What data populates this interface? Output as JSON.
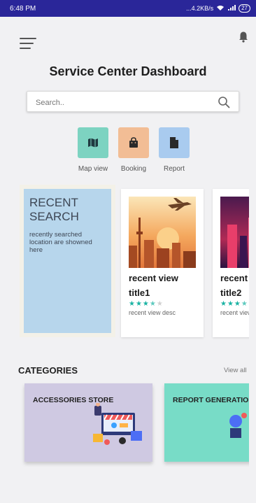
{
  "status_bar": {
    "time": "6:48 PM",
    "network_info": "...4.2KB/s",
    "battery": "27"
  },
  "header": {
    "title": "Service Center Dashboard",
    "menu_icon": "hamburger-menu-icon",
    "notification_icon": "bell-icon"
  },
  "search": {
    "placeholder": "Search..",
    "value": "",
    "icon": "search-icon"
  },
  "quick_actions": [
    {
      "label": "Map view",
      "icon": "map-icon",
      "color": "#7dd3c1"
    },
    {
      "label": "Booking",
      "icon": "shopping-bag-icon",
      "color": "#f2bd95"
    },
    {
      "label": "Report",
      "icon": "document-icon",
      "color": "#a9cbef"
    }
  ],
  "recent_search": {
    "title": "RECENT SEARCH",
    "description": "recently searched location are showned here"
  },
  "recent_views": [
    {
      "title_line1": "recent view",
      "title_line2": "title1",
      "rating": 3.5,
      "description": "recent view desc"
    },
    {
      "title_line1": "recent view",
      "title_line2": "title2",
      "rating": 3.5,
      "description": "recent view desc"
    }
  ],
  "categories": {
    "heading": "CATEGORIES",
    "view_all": "View all",
    "items": [
      {
        "label": "ACCESSORIES STORE",
        "color": "#cfc9e2"
      },
      {
        "label": "REPORT GENERATION",
        "color": "#78dcc7"
      }
    ]
  }
}
